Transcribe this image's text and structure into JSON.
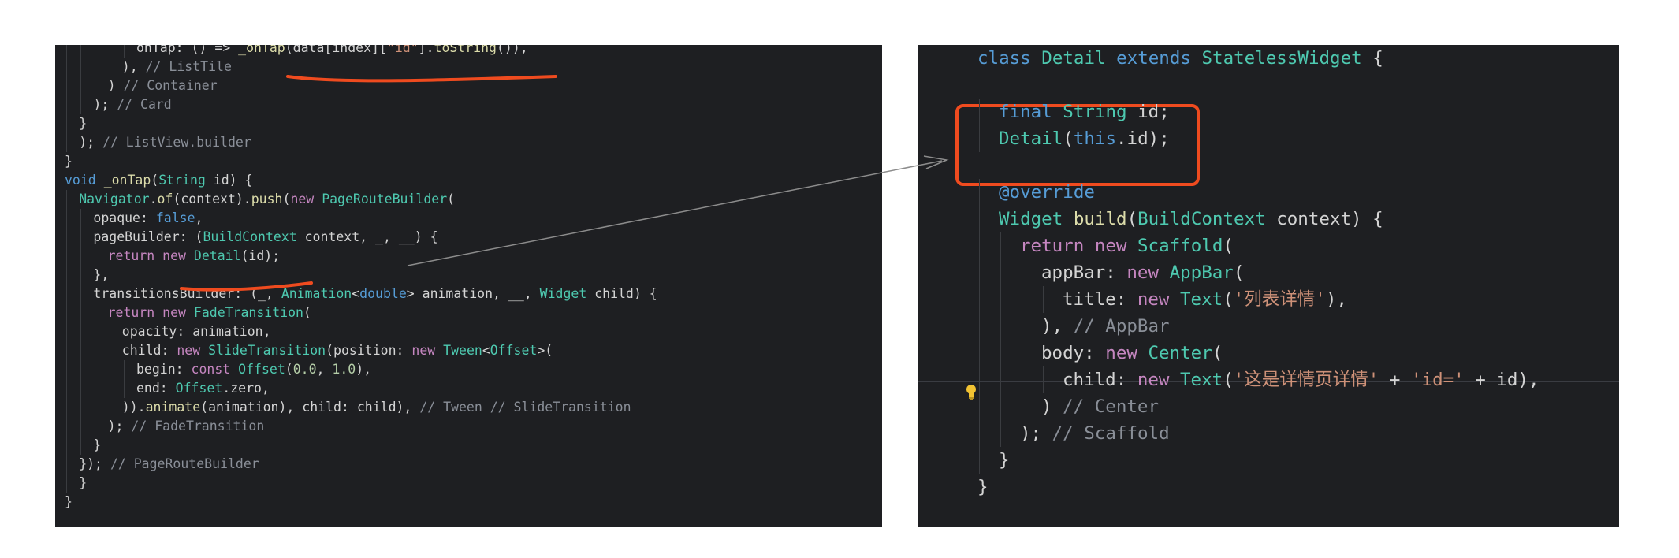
{
  "left_code": [
    {
      "indent": 5,
      "tokens": [
        [
          "plain",
          "onTap: () => "
        ],
        [
          "fn",
          "_onTap"
        ],
        [
          "plain",
          "(data[index]["
        ],
        [
          "str",
          "\"id\""
        ],
        [
          "plain",
          "]."
        ],
        [
          "fn",
          "toString"
        ],
        [
          "plain",
          "()),"
        ]
      ]
    },
    {
      "indent": 4,
      "tokens": [
        [
          "plain",
          "), "
        ],
        [
          "comment",
          "// ListTile"
        ]
      ]
    },
    {
      "indent": 3,
      "tokens": [
        [
          "plain",
          ") "
        ],
        [
          "comment",
          "// Container"
        ]
      ]
    },
    {
      "indent": 2,
      "tokens": [
        [
          "plain",
          "); "
        ],
        [
          "comment",
          "// Card"
        ]
      ]
    },
    {
      "indent": 1,
      "tokens": [
        [
          "plain",
          "}"
        ]
      ]
    },
    {
      "indent": 1,
      "tokens": [
        [
          "plain",
          "); "
        ],
        [
          "comment",
          "// ListView.builder"
        ]
      ]
    },
    {
      "indent": 0,
      "tokens": [
        [
          "plain",
          "}"
        ]
      ]
    },
    {
      "indent": 0,
      "tokens": [
        [
          "kw",
          "void"
        ],
        [
          "plain",
          " "
        ],
        [
          "fn",
          "_onTap"
        ],
        [
          "plain",
          "("
        ],
        [
          "type",
          "String"
        ],
        [
          "plain",
          " id) {"
        ]
      ]
    },
    {
      "indent": 1,
      "tokens": [
        [
          "type",
          "Navigator"
        ],
        [
          "plain",
          "."
        ],
        [
          "fn",
          "of"
        ],
        [
          "plain",
          "(context)."
        ],
        [
          "fn",
          "push"
        ],
        [
          "plain",
          "("
        ],
        [
          "kw2",
          "new"
        ],
        [
          "plain",
          " "
        ],
        [
          "type",
          "PageRouteBuilder"
        ],
        [
          "plain",
          "("
        ]
      ]
    },
    {
      "indent": 2,
      "tokens": [
        [
          "plain",
          "opaque: "
        ],
        [
          "kw",
          "false"
        ],
        [
          "plain",
          ","
        ]
      ]
    },
    {
      "indent": 2,
      "tokens": [
        [
          "plain",
          "pageBuilder: ("
        ],
        [
          "type",
          "BuildContext"
        ],
        [
          "plain",
          " context, _, __) {"
        ]
      ]
    },
    {
      "indent": 3,
      "tokens": [
        [
          "kw2",
          "return"
        ],
        [
          "plain",
          " "
        ],
        [
          "kw2",
          "new"
        ],
        [
          "plain",
          " "
        ],
        [
          "type",
          "Detail"
        ],
        [
          "plain",
          "(id);"
        ]
      ]
    },
    {
      "indent": 2,
      "tokens": [
        [
          "plain",
          "},"
        ]
      ]
    },
    {
      "indent": 2,
      "tokens": [
        [
          "plain",
          "transitionsBuilder: (_, "
        ],
        [
          "type",
          "Animation"
        ],
        [
          "plain",
          "<"
        ],
        [
          "kw",
          "double"
        ],
        [
          "plain",
          "> animation, __, "
        ],
        [
          "type",
          "Widget"
        ],
        [
          "plain",
          " child) {"
        ]
      ]
    },
    {
      "indent": 3,
      "tokens": [
        [
          "kw2",
          "return"
        ],
        [
          "plain",
          " "
        ],
        [
          "kw2",
          "new"
        ],
        [
          "plain",
          " "
        ],
        [
          "type",
          "FadeTransition"
        ],
        [
          "plain",
          "("
        ]
      ]
    },
    {
      "indent": 4,
      "tokens": [
        [
          "plain",
          "opacity: animation,"
        ]
      ]
    },
    {
      "indent": 4,
      "tokens": [
        [
          "plain",
          "child: "
        ],
        [
          "kw2",
          "new"
        ],
        [
          "plain",
          " "
        ],
        [
          "type",
          "SlideTransition"
        ],
        [
          "plain",
          "(position: "
        ],
        [
          "kw2",
          "new"
        ],
        [
          "plain",
          " "
        ],
        [
          "type",
          "Tween"
        ],
        [
          "plain",
          "<"
        ],
        [
          "type",
          "Offset"
        ],
        [
          "plain",
          ">("
        ]
      ]
    },
    {
      "indent": 5,
      "tokens": [
        [
          "plain",
          "begin: "
        ],
        [
          "kw2",
          "const"
        ],
        [
          "plain",
          " "
        ],
        [
          "type",
          "Offset"
        ],
        [
          "plain",
          "("
        ],
        [
          "num",
          "0.0"
        ],
        [
          "plain",
          ", "
        ],
        [
          "num",
          "1.0"
        ],
        [
          "plain",
          "),"
        ]
      ]
    },
    {
      "indent": 5,
      "tokens": [
        [
          "plain",
          "end: "
        ],
        [
          "type",
          "Offset"
        ],
        [
          "plain",
          ".zero,"
        ]
      ]
    },
    {
      "indent": 4,
      "tokens": [
        [
          "plain",
          "))."
        ],
        [
          "fn",
          "animate"
        ],
        [
          "plain",
          "(animation), child: child), "
        ],
        [
          "comment",
          "// Tween // SlideTransition"
        ]
      ]
    },
    {
      "indent": 3,
      "tokens": [
        [
          "plain",
          "); "
        ],
        [
          "comment",
          "// FadeTransition"
        ]
      ]
    },
    {
      "indent": 2,
      "tokens": [
        [
          "plain",
          "}"
        ]
      ]
    },
    {
      "indent": 1,
      "tokens": [
        [
          "plain",
          "}); "
        ],
        [
          "comment",
          "// PageRouteBuilder"
        ]
      ]
    },
    {
      "indent": 1,
      "tokens": [
        [
          "plain",
          "}"
        ]
      ]
    },
    {
      "indent": 0,
      "tokens": [
        [
          "plain",
          "}"
        ]
      ]
    }
  ],
  "right_code": [
    {
      "indent": 0,
      "tokens": [
        [
          "kw",
          "class"
        ],
        [
          "plain",
          " "
        ],
        [
          "type",
          "Detail"
        ],
        [
          "plain",
          " "
        ],
        [
          "kw",
          "extends"
        ],
        [
          "plain",
          " "
        ],
        [
          "type",
          "StatelessWidget"
        ],
        [
          "plain",
          " {"
        ]
      ]
    },
    {
      "indent": 0,
      "tokens": []
    },
    {
      "indent": 1,
      "tokens": [
        [
          "kw",
          "final"
        ],
        [
          "plain",
          " "
        ],
        [
          "type",
          "String"
        ],
        [
          "plain",
          " id;"
        ]
      ]
    },
    {
      "indent": 1,
      "tokens": [
        [
          "type",
          "Detail"
        ],
        [
          "plain",
          "("
        ],
        [
          "kw",
          "this"
        ],
        [
          "plain",
          ".id);"
        ]
      ]
    },
    {
      "indent": 0,
      "tokens": []
    },
    {
      "indent": 1,
      "tokens": [
        [
          "kw",
          "@override"
        ]
      ]
    },
    {
      "indent": 1,
      "tokens": [
        [
          "type",
          "Widget"
        ],
        [
          "plain",
          " "
        ],
        [
          "fn",
          "build"
        ],
        [
          "plain",
          "("
        ],
        [
          "type",
          "BuildContext"
        ],
        [
          "plain",
          " context) {"
        ]
      ]
    },
    {
      "indent": 2,
      "tokens": [
        [
          "kw2",
          "return"
        ],
        [
          "plain",
          " "
        ],
        [
          "kw2",
          "new"
        ],
        [
          "plain",
          " "
        ],
        [
          "type",
          "Scaffold"
        ],
        [
          "plain",
          "("
        ]
      ]
    },
    {
      "indent": 3,
      "tokens": [
        [
          "plain",
          "appBar: "
        ],
        [
          "kw2",
          "new"
        ],
        [
          "plain",
          " "
        ],
        [
          "type",
          "AppBar"
        ],
        [
          "plain",
          "("
        ]
      ]
    },
    {
      "indent": 4,
      "tokens": [
        [
          "plain",
          "title: "
        ],
        [
          "kw2",
          "new"
        ],
        [
          "plain",
          " "
        ],
        [
          "type",
          "Text"
        ],
        [
          "plain",
          "("
        ],
        [
          "str",
          "'列表详情'"
        ],
        [
          "plain",
          "),"
        ]
      ]
    },
    {
      "indent": 3,
      "tokens": [
        [
          "plain",
          "), "
        ],
        [
          "comment",
          "// AppBar"
        ]
      ]
    },
    {
      "indent": 3,
      "tokens": [
        [
          "plain",
          "body: "
        ],
        [
          "kw2",
          "new"
        ],
        [
          "plain",
          " "
        ],
        [
          "type",
          "Center"
        ],
        [
          "plain",
          "("
        ]
      ]
    },
    {
      "indent": 4,
      "tokens": [
        [
          "plain",
          "child: "
        ],
        [
          "kw2",
          "new"
        ],
        [
          "plain",
          " "
        ],
        [
          "type",
          "Text"
        ],
        [
          "plain",
          "("
        ],
        [
          "str",
          "'这是详情页详情'"
        ],
        [
          "plain",
          " + "
        ],
        [
          "str",
          "'id='"
        ],
        [
          "plain",
          " + id),"
        ]
      ]
    },
    {
      "indent": 3,
      "tokens": [
        [
          "plain",
          ") "
        ],
        [
          "comment",
          "// Center"
        ]
      ]
    },
    {
      "indent": 2,
      "tokens": [
        [
          "plain",
          "); "
        ],
        [
          "comment",
          "// Scaffold"
        ]
      ]
    },
    {
      "indent": 1,
      "tokens": [
        [
          "plain",
          "}"
        ]
      ]
    },
    {
      "indent": 0,
      "tokens": [
        [
          "plain",
          "}"
        ]
      ]
    }
  ],
  "annotations": {
    "underline_color": "#ef4b1f",
    "box_color": "#ef4b1f",
    "arrow_color": "#8c8c8c"
  },
  "icons": {
    "lightbulb": "lightbulb-icon"
  }
}
